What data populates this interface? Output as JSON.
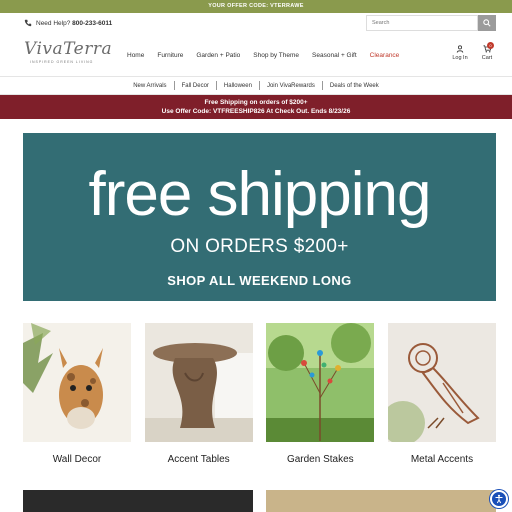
{
  "promo_top": "YOUR OFFER CODE: VTERRAWE",
  "utility": {
    "help_label": "Need Help?",
    "phone": "800-233-6011"
  },
  "search": {
    "placeholder": "Search"
  },
  "logo": {
    "name": "VivaTerra",
    "tagline": "INSPIRED GREEN LIVING"
  },
  "nav": {
    "items": [
      "Home",
      "Furniture",
      "Garden + Patio",
      "Shop by Theme",
      "Seasonal + Gift"
    ],
    "clearance": "Clearance"
  },
  "account": {
    "login": "Log In",
    "cart": "Cart",
    "cart_count": "0"
  },
  "subnav": [
    "New Arrivals",
    "Fall Decor",
    "Halloween",
    "Join VivaRewards",
    "Deals of the Week"
  ],
  "shipbar": {
    "line1": "Free Shipping on orders of $200+",
    "line2": "Use Offer Code: VTFREESHIP826 At Check Out. Ends 8/23/26"
  },
  "hero": {
    "headline": "free shipping",
    "sub": "ON ORDERS $200+",
    "cta": "SHOP ALL WEEKEND LONG"
  },
  "tiles": [
    {
      "label": "Wall Decor"
    },
    {
      "label": "Accent Tables"
    },
    {
      "label": "Garden Stakes"
    },
    {
      "label": "Metal Accents"
    }
  ],
  "colors": {
    "promo": "#8a9a4d",
    "ship_bar": "#7f1f2a",
    "hero": "#336d74",
    "clearance": "#c0392b"
  }
}
